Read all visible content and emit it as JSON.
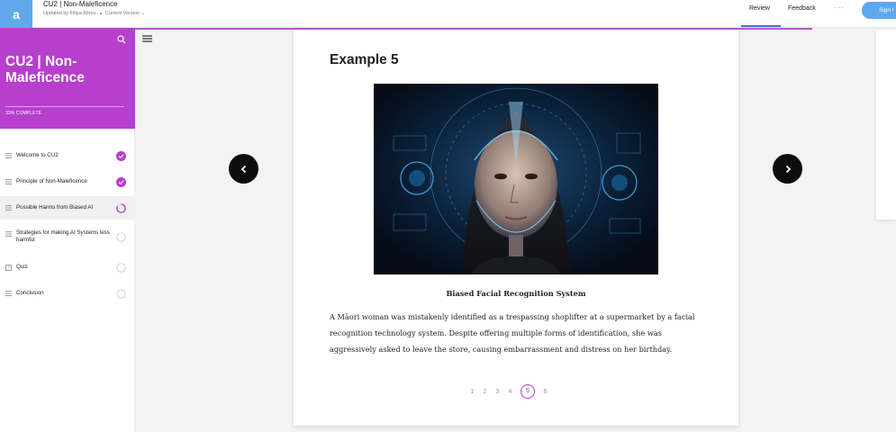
{
  "topbar": {
    "logo": "a",
    "course_title": "CU2 | Non-Maleficence",
    "updated_by": "Updated by Filipa Abreu",
    "version": "Current Version ⌄",
    "tabs": [
      {
        "label": "Review",
        "active": true
      },
      {
        "label": "Feedback",
        "active": false
      }
    ],
    "more": "···",
    "signin": "Sign I"
  },
  "sidebar": {
    "title": "CU2 | Non-Maleficence",
    "progress": "33% COMPLETE",
    "progress_value_percent": 33,
    "accent_color": "#b63fcd",
    "items": [
      {
        "label": "Welcome to CU2",
        "icon": "lines-icon",
        "status": "complete"
      },
      {
        "label": "Principle of Non-Maleficence",
        "icon": "lines-icon",
        "status": "complete"
      },
      {
        "label": "Possible Harms from Biased AI",
        "icon": "lines-icon",
        "status": "in-progress"
      },
      {
        "label": "Strategies for making AI Systems less harmful",
        "icon": "lines-icon",
        "status": "not-started"
      },
      {
        "label": "Quiz",
        "icon": "quiz-icon",
        "status": "not-started"
      },
      {
        "label": "Conclusion",
        "icon": "lines-icon",
        "status": "not-started"
      }
    ]
  },
  "main": {
    "title": "Example 5",
    "caption": "Biased Facial Recognition System",
    "paragraph": "A Māori woman was mistakenly identified as a trespassing shoplifter at a supermarket by a facial recognition technology system. Despite offering multiple forms of identification, she was aggressively asked to leave the store, causing embarrassment and distress on her birthday.",
    "pages": [
      "1",
      "2",
      "3",
      "4",
      "5",
      "6"
    ],
    "current_page": "5"
  }
}
